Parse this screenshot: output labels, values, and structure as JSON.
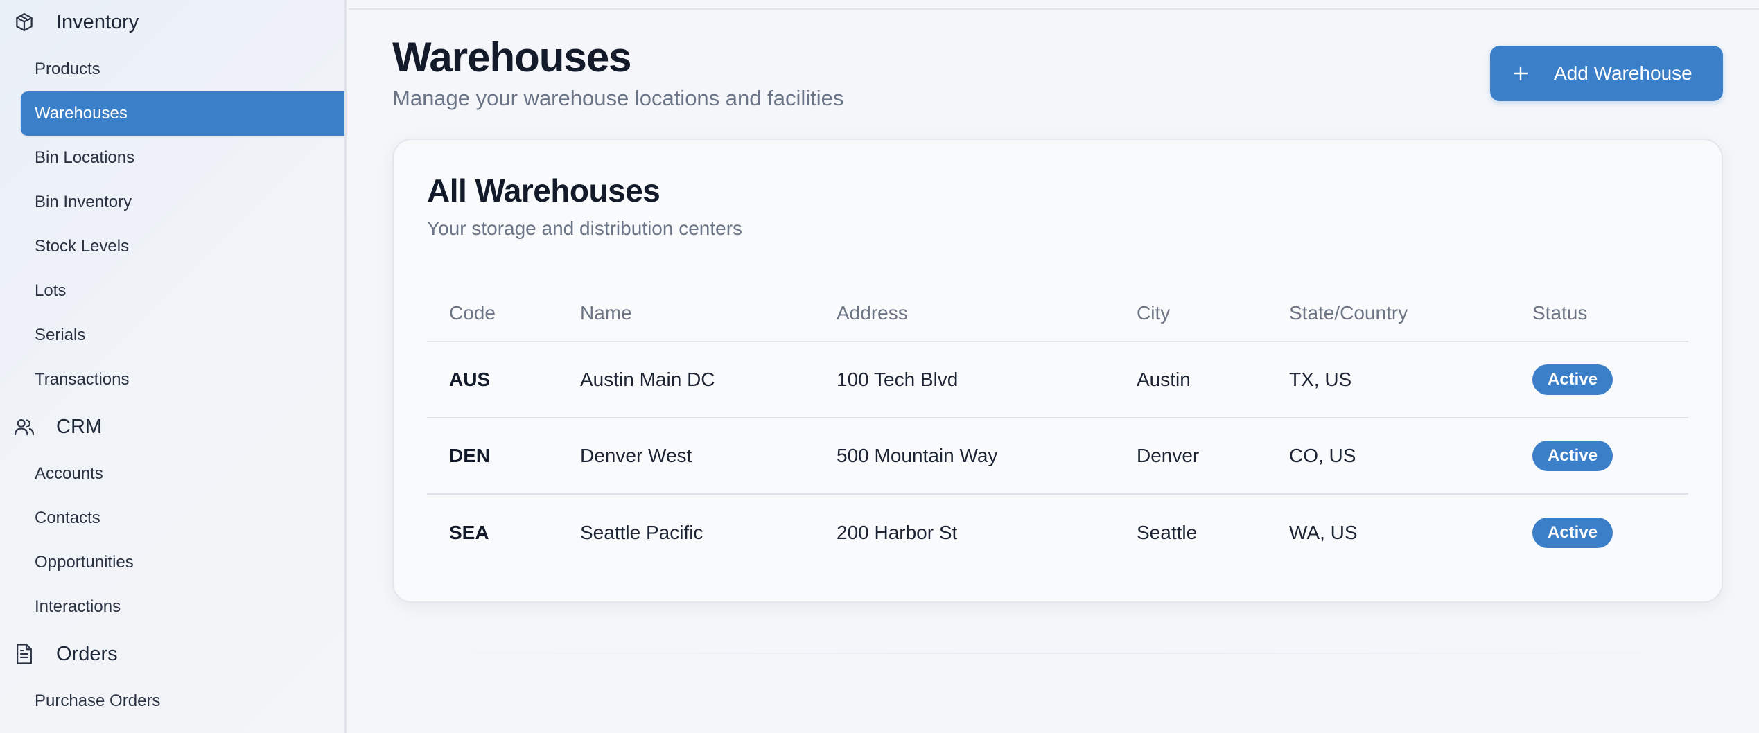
{
  "sidebar": {
    "sections": [
      {
        "label": "Inventory",
        "icon": "box-icon",
        "items": [
          {
            "label": "Products",
            "active": false
          },
          {
            "label": "Warehouses",
            "active": true
          },
          {
            "label": "Bin Locations",
            "active": false
          },
          {
            "label": "Bin Inventory",
            "active": false
          },
          {
            "label": "Stock Levels",
            "active": false
          },
          {
            "label": "Lots",
            "active": false
          },
          {
            "label": "Serials",
            "active": false
          },
          {
            "label": "Transactions",
            "active": false
          }
        ]
      },
      {
        "label": "CRM",
        "icon": "users-icon",
        "items": [
          {
            "label": "Accounts",
            "active": false
          },
          {
            "label": "Contacts",
            "active": false
          },
          {
            "label": "Opportunities",
            "active": false
          },
          {
            "label": "Interactions",
            "active": false
          }
        ]
      },
      {
        "label": "Orders",
        "icon": "document-icon",
        "items": [
          {
            "label": "Purchase Orders",
            "active": false
          }
        ]
      }
    ]
  },
  "header": {
    "title": "Warehouses",
    "subtitle": "Manage your warehouse locations and facilities",
    "add_button_label": "Add Warehouse"
  },
  "card": {
    "title": "All Warehouses",
    "subtitle": "Your storage and distribution centers"
  },
  "table": {
    "columns": [
      "Code",
      "Name",
      "Address",
      "City",
      "State/Country",
      "Status"
    ],
    "rows": [
      {
        "code": "AUS",
        "name": "Austin Main DC",
        "address": "100 Tech Blvd",
        "city": "Austin",
        "state_country": "TX, US",
        "status": "Active"
      },
      {
        "code": "DEN",
        "name": "Denver West",
        "address": "500 Mountain Way",
        "city": "Denver",
        "state_country": "CO, US",
        "status": "Active"
      },
      {
        "code": "SEA",
        "name": "Seattle Pacific",
        "address": "200 Harbor St",
        "city": "Seattle",
        "state_country": "WA, US",
        "status": "Active"
      }
    ]
  },
  "colors": {
    "accent": "#3a7fc8",
    "page_background": "#f4f6f9",
    "text_primary": "#131a2a",
    "text_muted": "#6a7486"
  }
}
